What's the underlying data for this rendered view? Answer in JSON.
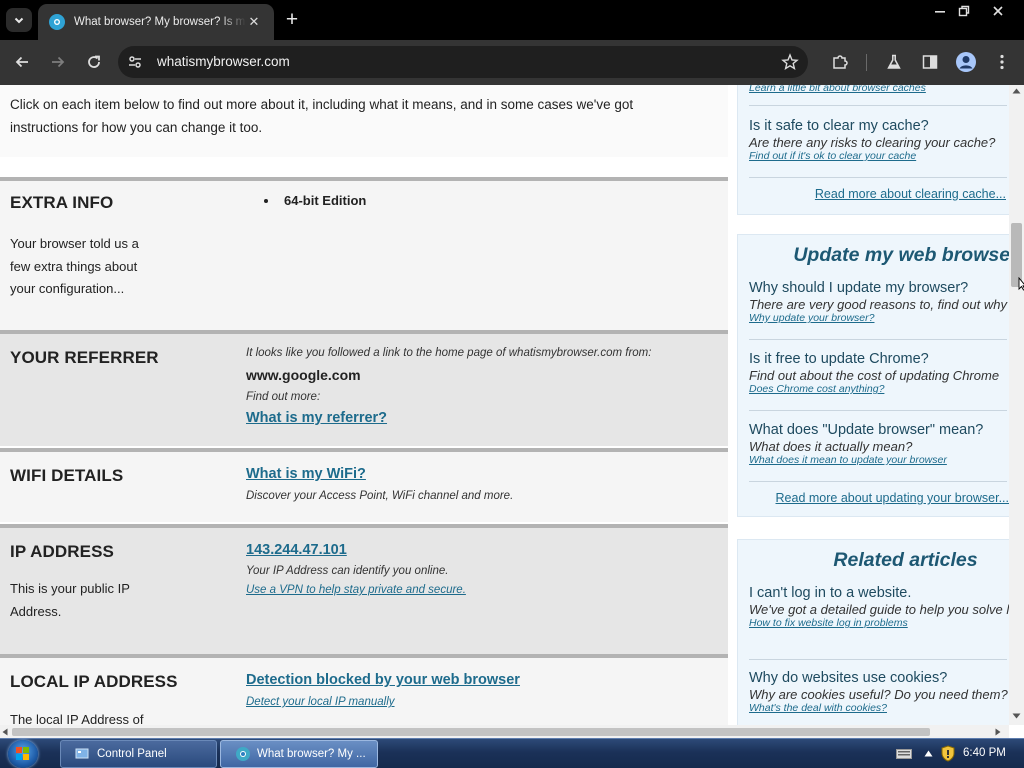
{
  "browser": {
    "active_tab_title": "What browser? My browser? Is my browser up to date?",
    "url": "whatismybrowser.com",
    "new_tab_glyph": "+"
  },
  "page": {
    "intro": "Click on each item below to find out more about it, including what it means, and in some cases we've got instructions for how you can change it too.",
    "extra_info": {
      "heading": "EXTRA INFO",
      "desc": "Your browser told us a few extra things about your configuration...",
      "bullet": "64-bit Edition"
    },
    "referrer": {
      "heading": "YOUR REFERRER",
      "note": "It looks like you followed a link to the home page of whatismybrowser.com from:",
      "value": "www.google.com",
      "find_out": "Find out more:",
      "link": "What is my referrer?"
    },
    "wifi": {
      "heading": "WIFI DETAILS",
      "link": "What is my WiFi?",
      "note": "Discover your Access Point, WiFi channel and more."
    },
    "ip": {
      "heading": "IP ADDRESS",
      "desc": "This is your public IP Address.",
      "value": "143.244.47.101",
      "note": "Your IP Address can identify you online.",
      "link": "Use a VPN to help stay private and secure."
    },
    "local_ip": {
      "heading": "LOCAL IP ADDRESS",
      "link": "Detection blocked by your web browser",
      "sublink": "Detect your local IP manually",
      "desc": "The local IP Address of"
    }
  },
  "sidebar": {
    "cache_box": {
      "top_link": "Learn a little bit about browser caches",
      "articles": [
        {
          "title": "Is it safe to clear my cache?",
          "sub": "Are there any risks to clearing your cache?",
          "link": "Find out if it's ok to clear your cache"
        }
      ],
      "read_more": "Read more about clearing cache..."
    },
    "update_box": {
      "title": "Update my web browser",
      "articles": [
        {
          "title": "Why should I update my browser?",
          "sub": "There are very good reasons to, find out why",
          "link": "Why update your browser?"
        },
        {
          "title": "Is it free to update Chrome?",
          "sub": "Find out about the cost of updating Chrome",
          "link": "Does Chrome cost anything?"
        },
        {
          "title": "What does \"Update browser\" mean?",
          "sub": "What does it actually mean?",
          "link": "What does it mean to update your browser"
        }
      ],
      "read_more": "Read more about updating your browser..."
    },
    "related_box": {
      "title": "Related articles",
      "articles": [
        {
          "title": "I can't log in to a website.",
          "sub": "We've got a detailed guide to help you solve login problems",
          "link": "How to fix website log in problems"
        },
        {
          "title": "Why do websites use cookies?",
          "sub": "Why are cookies useful? Do you need them?",
          "link": "What's the deal with cookies?"
        }
      ]
    }
  },
  "taskbar": {
    "items": [
      "Control Panel",
      "What browser? My ..."
    ],
    "clock": "6:40 PM"
  }
}
